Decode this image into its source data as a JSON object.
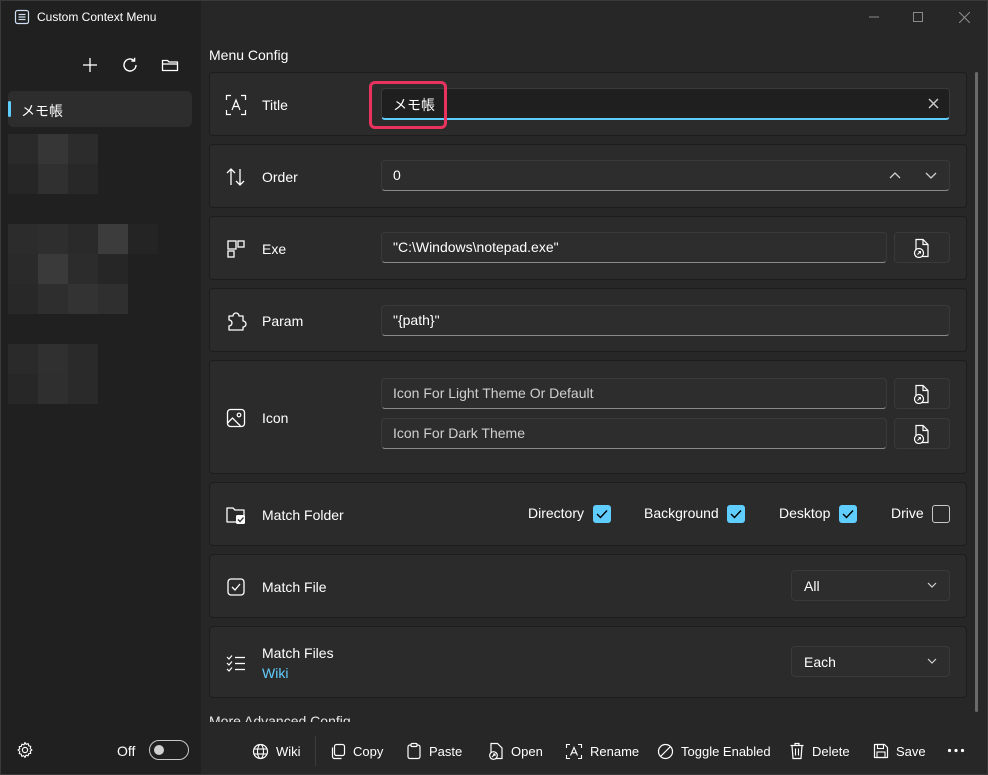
{
  "app": {
    "title": "Custom Context Menu"
  },
  "window_controls": [
    "minimize",
    "maximize",
    "close"
  ],
  "sidebar": {
    "tools": [
      "add-icon",
      "refresh-icon",
      "folder-icon"
    ],
    "selected_item": "メモ帳"
  },
  "section_title": "Menu Config",
  "fields": {
    "title": {
      "label": "Title",
      "value": "メモ帳"
    },
    "order": {
      "label": "Order",
      "value": "0"
    },
    "exe": {
      "label": "Exe",
      "value": "\"C:\\Windows\\notepad.exe\""
    },
    "param": {
      "label": "Param",
      "value": "\"{path}\""
    },
    "icon": {
      "label": "Icon",
      "light_placeholder": "Icon For Light Theme Or Default",
      "dark_placeholder": "Icon For Dark Theme"
    }
  },
  "match_folder": {
    "label": "Match Folder",
    "options": [
      {
        "label": "Directory",
        "checked": true
      },
      {
        "label": "Background",
        "checked": true
      },
      {
        "label": "Desktop",
        "checked": true
      },
      {
        "label": "Drive",
        "checked": false
      }
    ]
  },
  "match_file": {
    "label": "Match File",
    "selected": "All"
  },
  "match_files": {
    "label": "Match Files",
    "link": "Wiki",
    "selected": "Each"
  },
  "next_section_partial": "More Advanced Config",
  "footer": {
    "toggle_label": "Off",
    "toggle_on": false,
    "buttons": {
      "wiki": "Wiki",
      "copy": "Copy",
      "paste": "Paste",
      "open": "Open",
      "rename": "Rename",
      "toggle_enabled": "Toggle Enabled",
      "delete": "Delete",
      "save": "Save"
    }
  },
  "colors": {
    "accent": "#60cdff",
    "highlight": "#e8335f",
    "background": "#202020",
    "card": "#2b2b2b"
  }
}
